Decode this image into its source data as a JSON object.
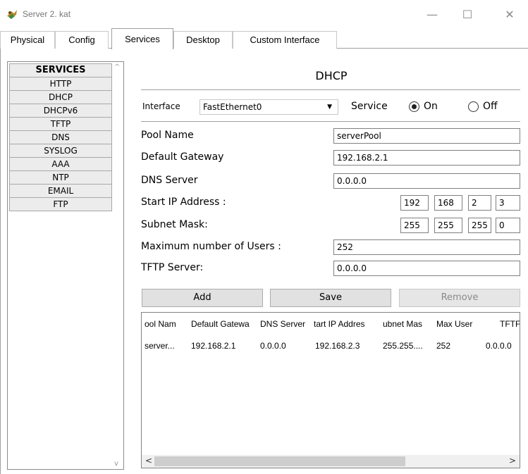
{
  "window": {
    "title": "Server 2. kat",
    "minimize": "—",
    "maximize": "☐",
    "close": "✕"
  },
  "tabs": [
    "Physical",
    "Config",
    "Services",
    "Desktop",
    "Custom Interface"
  ],
  "services": {
    "header": "SERVICES",
    "items": [
      "HTTP",
      "DHCP",
      "DHCPv6",
      "TFTP",
      "DNS",
      "SYSLOG",
      "AAA",
      "NTP",
      "EMAIL",
      "FTP"
    ]
  },
  "dhcp": {
    "title": "DHCP",
    "interface_label": "Interface",
    "interface_value": "FastEthernet0",
    "service_label": "Service",
    "on_label": "On",
    "off_label": "Off",
    "service_state": "On",
    "pool_name_label": "Pool Name",
    "pool_name_value": "serverPool",
    "gateway_label": "Default Gateway",
    "gateway_value": "192.168.2.1",
    "dns_label": "DNS Server",
    "dns_value": "0.0.0.0",
    "start_ip_label": "Start IP Address :",
    "start_ip": [
      "192",
      "168",
      "2",
      "3"
    ],
    "subnet_label": "Subnet Mask:",
    "subnet": [
      "255",
      "255",
      "255",
      "0"
    ],
    "max_users_label": "Maximum number of Users :",
    "max_users_value": "252",
    "tftp_label": "TFTP Server:",
    "tftp_value": "0.0.0.0",
    "add_label": "Add",
    "save_label": "Save",
    "remove_label": "Remove"
  },
  "pool_table": {
    "columns": [
      "ool Nam",
      "Default Gatewa",
      "DNS Server",
      "tart IP Addres",
      "ubnet Mas",
      "Max User",
      "TFTF"
    ],
    "rows": [
      [
        "server...",
        "192.168.2.1",
        "0.0.0.0",
        "192.168.2.3",
        "255.255....",
        "252",
        "0.0.0.0"
      ]
    ]
  },
  "scroll": {
    "left": "<",
    "right": ">",
    "up": "^",
    "down": "v"
  }
}
